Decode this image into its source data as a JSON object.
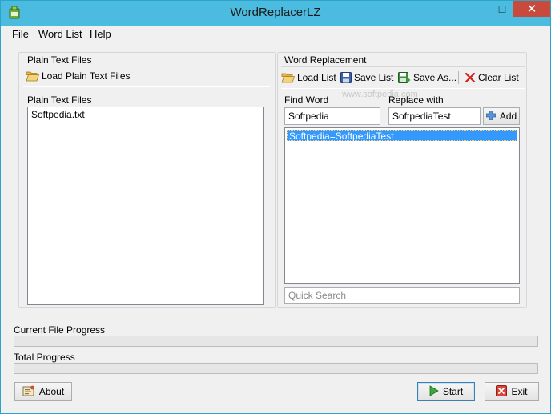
{
  "window": {
    "title": "WordReplacerLZ",
    "controls": {
      "minimize": "–",
      "maximize": "□",
      "close": "✕"
    }
  },
  "menu": {
    "items": [
      "File",
      "Word List",
      "Help"
    ]
  },
  "left_panel": {
    "group_title": "Plain Text Files",
    "load_label": "Load Plain Text Files",
    "list_title": "Plain Text Files",
    "files": [
      "Softpedia.txt"
    ]
  },
  "right_panel": {
    "group_title": "Word Replacement",
    "toolbar": {
      "load": "Load List",
      "save": "Save List",
      "save_as": "Save As...",
      "clear": "Clear List"
    },
    "find_label": "Find Word",
    "replace_label": "Replace with",
    "find_value": "Softpedia",
    "replace_value": "SoftpediaTest",
    "add_label": "Add",
    "pairs": [
      "Softpedia=SoftpediaTest"
    ],
    "quick_search_placeholder": "Quick Search",
    "watermark": "www.softpedia.com"
  },
  "progress": {
    "current_label": "Current File Progress",
    "current_fraction": 0,
    "total_label": "Total Progress",
    "total_fraction": 0
  },
  "buttons": {
    "about": "About",
    "start": "Start",
    "exit": "Exit"
  },
  "colors": {
    "titlebar": "#4bbbe0",
    "selection": "#3399ff",
    "close": "#c74a3c"
  }
}
